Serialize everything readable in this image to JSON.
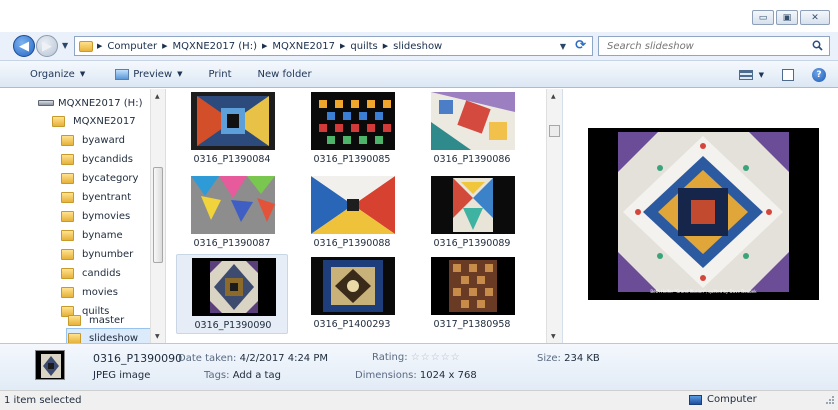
{
  "window": {
    "minimize": "▭",
    "maximize": "▣",
    "close": "✕"
  },
  "address": {
    "crumbs": [
      "Computer",
      "MQXNE2017 (H:)",
      "MQXNE2017",
      "quilts",
      "slideshow"
    ],
    "search_placeholder": "Search slideshow"
  },
  "toolbar": {
    "organize": "Organize",
    "preview": "Preview",
    "print": "Print",
    "new_folder": "New folder"
  },
  "tree": {
    "drive": "MQXNE2017 (H:)",
    "root": "MQXNE2017",
    "items": [
      "byaward",
      "bycandids",
      "bycategory",
      "byentrant",
      "bymovies",
      "byname",
      "bynumber",
      "candids",
      "movies",
      "quilts",
      "master",
      "slideshow"
    ]
  },
  "files": [
    {
      "name": "0316_P1390084"
    },
    {
      "name": "0316_P1390085"
    },
    {
      "name": "0316_P1390086"
    },
    {
      "name": "0316_P1390087"
    },
    {
      "name": "0316_P1390088"
    },
    {
      "name": "0316_P1390089"
    },
    {
      "name": "0316_P1390090"
    },
    {
      "name": "0316_P1400293"
    },
    {
      "name": "0317_P1380958"
    }
  ],
  "preview": {
    "caption": "Beth Helfer \"Grand Illusion\", quilted by Dave Doubek"
  },
  "details": {
    "name": "0316_P1390090",
    "type": "JPEG image",
    "date_label": "Date taken:",
    "date_value": "4/2/2017 4:24 PM",
    "tags_label": "Tags:",
    "tags_value": "Add a tag",
    "rating_label": "Rating:",
    "rating_stars": "☆☆☆☆☆",
    "dimensions_label": "Dimensions:",
    "dimensions_value": "1024 x 768",
    "size_label": "Size:",
    "size_value": "234 KB"
  },
  "status": {
    "selection": "1 item selected",
    "location": "Computer"
  }
}
